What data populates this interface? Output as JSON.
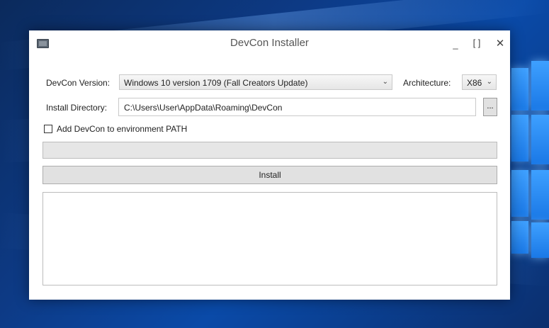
{
  "window": {
    "title": "DevCon Installer",
    "minimize_glyph": "_",
    "maximize_glyph": "[ ]",
    "close_glyph": "✕"
  },
  "form": {
    "version_label": "DevCon Version:",
    "version_value": "Windows 10 version 1709 (Fall Creators Update)",
    "architecture_label": "Architecture:",
    "architecture_value": "X86",
    "directory_label": "Install Directory:",
    "directory_value": "C:\\Users\\User\\AppData\\Roaming\\DevCon",
    "browse_label": "...",
    "path_checkbox_label": "Add DevCon to environment PATH",
    "path_checkbox_checked": false,
    "progress_fraction": 0,
    "install_label": "Install",
    "log_text": ""
  },
  "colors": {
    "desktop_blue": "#0d3a85",
    "window_bg": "#ffffff",
    "button_bg": "#e1e1e1"
  }
}
